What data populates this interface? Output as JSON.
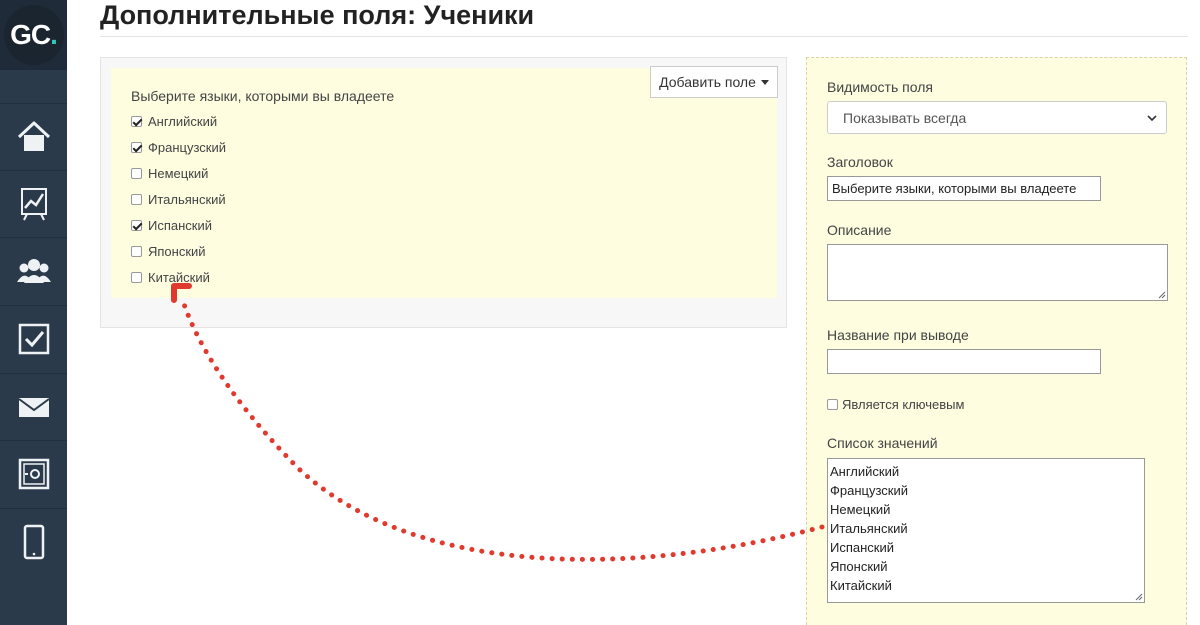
{
  "sidebar": {
    "logo_text": "GC",
    "logo_dot": ".",
    "items": [
      {
        "icon": "home-icon"
      },
      {
        "icon": "chart-icon"
      },
      {
        "icon": "users-icon"
      },
      {
        "icon": "task-icon"
      },
      {
        "icon": "mail-icon"
      },
      {
        "icon": "safe-icon"
      },
      {
        "icon": "mobile-icon"
      }
    ]
  },
  "page": {
    "title": "Дополнительные поля: Ученики"
  },
  "preview": {
    "field_label": "Выберите языки, которыми вы владеете",
    "add_field_button": "Добавить поле",
    "options": [
      {
        "label": "Английский",
        "checked": true
      },
      {
        "label": "Французский",
        "checked": true
      },
      {
        "label": "Немецкий",
        "checked": false
      },
      {
        "label": "Итальянский",
        "checked": false
      },
      {
        "label": "Испанский",
        "checked": true
      },
      {
        "label": "Японский",
        "checked": false
      },
      {
        "label": "Китайский",
        "checked": false
      }
    ]
  },
  "settings": {
    "visibility_label": "Видимость поля",
    "visibility_value": "Показывать всегда",
    "heading_label": "Заголовок",
    "heading_value": "Выберите языки, которыми вы владеете",
    "description_label": "Описание",
    "description_value": "",
    "output_name_label": "Название при выводе",
    "output_name_value": "",
    "is_key_label": "Является ключевым",
    "is_key_checked": false,
    "values_label": "Список значений",
    "values": [
      "Английский",
      "Французский",
      "Немецкий",
      "Итальянский",
      "Испанский",
      "Японский",
      "Китайский"
    ]
  },
  "colors": {
    "sidebar_bg": "#2b3a4a",
    "panel_yellow": "#fefde0",
    "annotation_red": "#e03a2f",
    "logo_accent": "#2ec4b6"
  }
}
